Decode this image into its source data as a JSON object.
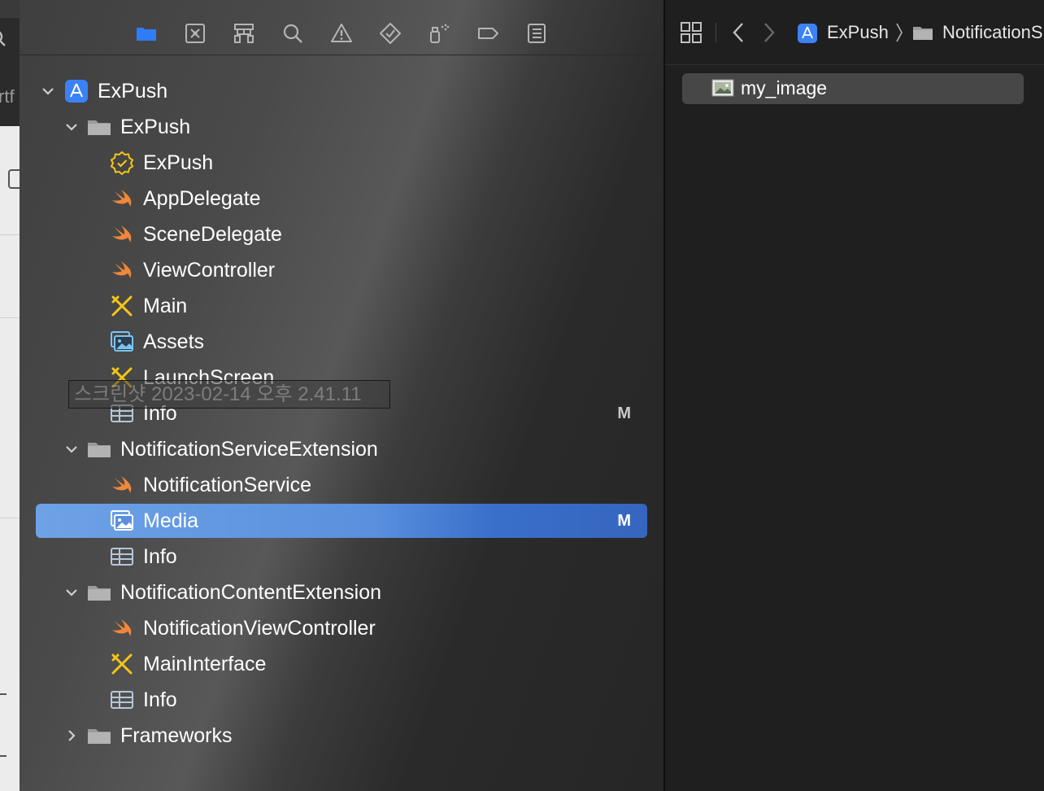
{
  "toolbar": {
    "icons": [
      "folder-icon",
      "source-control-icon",
      "symbol-hierarchy-icon",
      "find-icon",
      "warning-icon",
      "test-diamond-icon",
      "debug-spray-icon",
      "breakpoint-icon",
      "report-icon"
    ]
  },
  "tree": {
    "project": {
      "label": "ExPush"
    },
    "groups": [
      {
        "label": "ExPush",
        "files": [
          {
            "label": "ExPush",
            "icon": "app-seal-icon",
            "badge": ""
          },
          {
            "label": "AppDelegate",
            "icon": "swift-icon",
            "badge": ""
          },
          {
            "label": "SceneDelegate",
            "icon": "swift-icon",
            "badge": ""
          },
          {
            "label": "ViewController",
            "icon": "swift-icon",
            "badge": ""
          },
          {
            "label": "Main",
            "icon": "storyboard-icon",
            "badge": ""
          },
          {
            "label": "Assets",
            "icon": "asset-catalog-icon",
            "badge": ""
          },
          {
            "label": "LaunchScreen",
            "icon": "storyboard-icon",
            "badge": ""
          },
          {
            "label": "Info",
            "icon": "plist-table-icon",
            "badge": "M"
          }
        ]
      },
      {
        "label": "NotificationServiceExtension",
        "files": [
          {
            "label": "NotificationService",
            "icon": "swift-icon",
            "badge": ""
          },
          {
            "label": "Media",
            "icon": "asset-catalog-icon",
            "badge": "M",
            "selected": true
          },
          {
            "label": "Info",
            "icon": "plist-table-icon",
            "badge": ""
          }
        ]
      },
      {
        "label": "NotificationContentExtension",
        "files": [
          {
            "label": "NotificationViewController",
            "icon": "swift-icon",
            "badge": ""
          },
          {
            "label": "MainInterface",
            "icon": "storyboard-icon",
            "badge": ""
          },
          {
            "label": "Info",
            "icon": "plist-table-icon",
            "badge": ""
          }
        ]
      },
      {
        "label": "Frameworks",
        "collapsed": true
      }
    ]
  },
  "tooltip": {
    "text": "스크린샷 2023-02-14 오후 2.41.11"
  },
  "jump_bar": {
    "project": "ExPush",
    "group": "NotificationS"
  },
  "asset_list": {
    "items": [
      {
        "label": "my_image"
      }
    ]
  },
  "left_sliver": {
    "text": "rtf"
  },
  "colors": {
    "selection": "#5a90de",
    "swift": "#f0873a",
    "storyboard": "#f5c518",
    "asset": "#7cc4f0",
    "project": "#3b82f6"
  }
}
